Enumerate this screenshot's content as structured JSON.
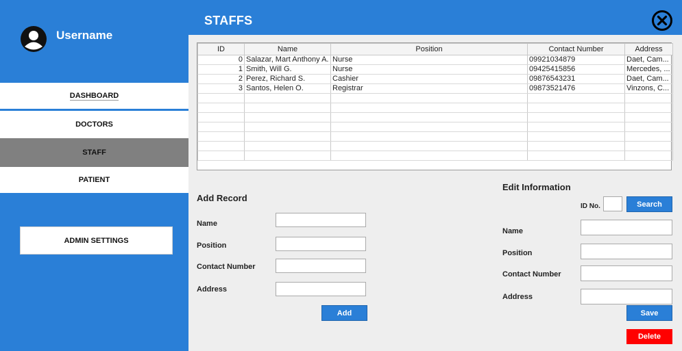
{
  "sidebar": {
    "username": "Username",
    "nav": [
      "DASHBOARD",
      "DOCTORS",
      "STAFF",
      "PATIENT"
    ],
    "admin_settings": "ADMIN SETTINGS"
  },
  "header": {
    "title": "STAFFS"
  },
  "table": {
    "columns": [
      "ID",
      "Name",
      "Position",
      "Contact Number",
      "Address"
    ],
    "rows": [
      [
        "0",
        "Salazar, Mart Anthony A.",
        "Nurse",
        "09921034879",
        "Daet, Cam..."
      ],
      [
        "1",
        "Smith, Will G.",
        "Nurse",
        "09425415856",
        "Mercedes, ..."
      ],
      [
        "2",
        "Perez, Richard S.",
        "Cashier",
        "09876543231",
        "Daet, Cam..."
      ],
      [
        "3",
        "Santos, Helen O.",
        "Registrar",
        "09873521476",
        "Vinzons, C..."
      ]
    ]
  },
  "add_record": {
    "title": "Add Record",
    "labels": [
      "Name",
      "Position",
      "Contact Number",
      "Address"
    ],
    "values": [
      "",
      "",
      "",
      ""
    ],
    "button": "Add"
  },
  "edit_info": {
    "title": "Edit Information",
    "id_label": "ID No.",
    "id_value": "",
    "search_button": "Search",
    "labels": [
      "Name",
      "Position",
      "Contact Number",
      "Address"
    ],
    "values": [
      "",
      "",
      "",
      ""
    ],
    "save_button": "Save",
    "delete_button": "Delete"
  },
  "colors": {
    "accent": "#2a7fd7",
    "selected_nav": "#808080",
    "danger": "#ff0000",
    "panel": "#eeeeee"
  }
}
